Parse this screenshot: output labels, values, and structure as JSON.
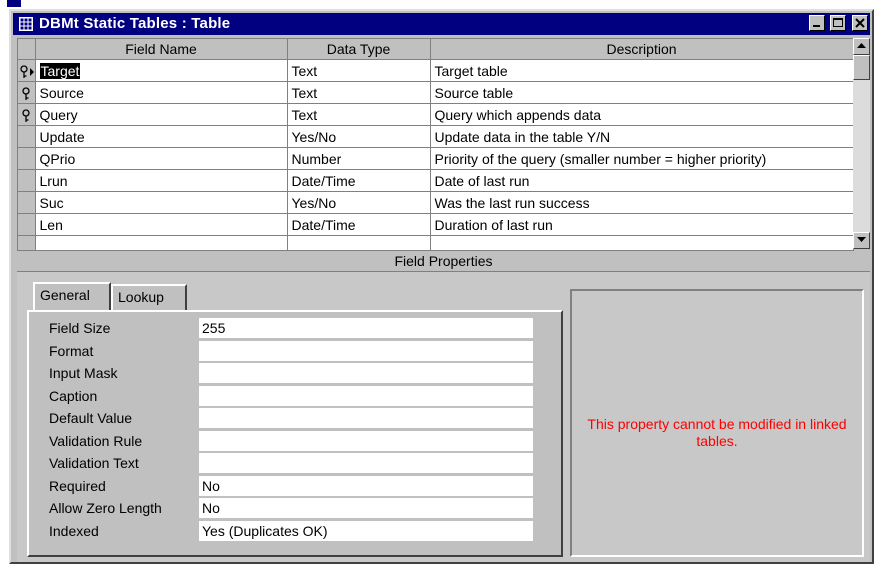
{
  "window": {
    "title": "DBMt Static Tables : Table",
    "buttons": [
      "minimize",
      "maximize",
      "close"
    ]
  },
  "grid": {
    "columns": [
      "Field Name",
      "Data Type",
      "Description"
    ],
    "rows": [
      {
        "field": "Target",
        "type": "Text",
        "desc": "Target table",
        "key": true,
        "current": true
      },
      {
        "field": "Source",
        "type": "Text",
        "desc": "Source table",
        "key": true,
        "current": false
      },
      {
        "field": "Query",
        "type": "Text",
        "desc": "Query which appends data",
        "key": true,
        "current": false
      },
      {
        "field": "Update",
        "type": "Yes/No",
        "desc": "Update data in the table Y/N",
        "key": false,
        "current": false
      },
      {
        "field": "QPrio",
        "type": "Number",
        "desc": "Priority of the query (smaller number = higher priority)",
        "key": false,
        "current": false
      },
      {
        "field": "Lrun",
        "type": "Date/Time",
        "desc": "Date of last run",
        "key": false,
        "current": false
      },
      {
        "field": "Suc",
        "type": "Yes/No",
        "desc": "Was the last run success",
        "key": false,
        "current": false
      },
      {
        "field": "Len",
        "type": "Date/Time",
        "desc": "Duration of last run",
        "key": false,
        "current": false
      }
    ]
  },
  "field_properties": {
    "title": "Field Properties",
    "tabs": [
      "General",
      "Lookup"
    ],
    "active_tab": "General",
    "properties": [
      {
        "label": "Field Size",
        "value": "255"
      },
      {
        "label": "Format",
        "value": ""
      },
      {
        "label": "Input Mask",
        "value": ""
      },
      {
        "label": "Caption",
        "value": ""
      },
      {
        "label": "Default Value",
        "value": ""
      },
      {
        "label": "Validation Rule",
        "value": ""
      },
      {
        "label": "Validation Text",
        "value": ""
      },
      {
        "label": "Required",
        "value": "No"
      },
      {
        "label": "Allow Zero Length",
        "value": "No"
      },
      {
        "label": "Indexed",
        "value": "Yes (Duplicates OK)"
      }
    ],
    "help_text": "This property cannot be modified in linked tables."
  },
  "colors": {
    "title_bar": "#000080",
    "face": "#c0c0c0",
    "help_text": "#ff0000"
  }
}
